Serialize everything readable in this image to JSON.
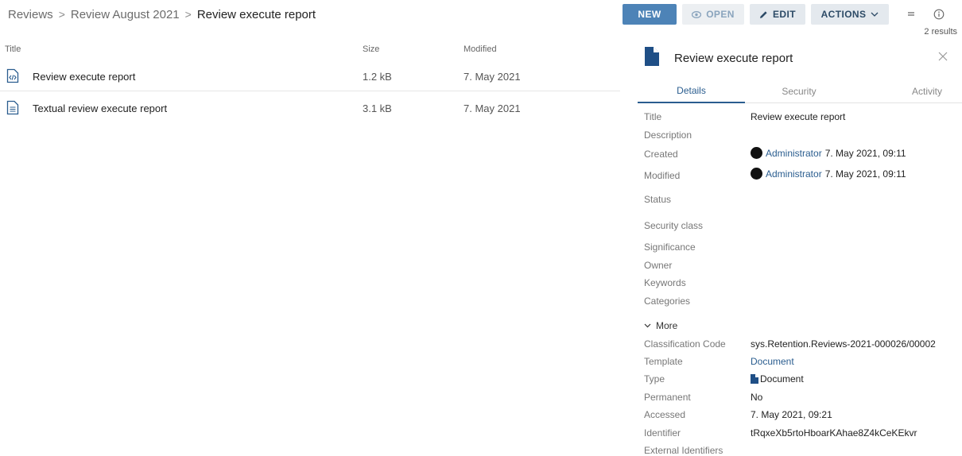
{
  "breadcrumb": {
    "items": [
      "Reviews",
      "Review August 2021"
    ],
    "current": "Review execute report"
  },
  "toolbar": {
    "new_label": "NEW",
    "open_label": "OPEN",
    "edit_label": "EDIT",
    "actions_label": "ACTIONS",
    "results_text": "2 results"
  },
  "list": {
    "columns": {
      "title": "Title",
      "size": "Size",
      "modified": "Modified"
    },
    "rows": [
      {
        "title": "Review execute report",
        "size": "1.2 kB",
        "modified": "7. May 2021",
        "icon": "code-file-icon"
      },
      {
        "title": "Textual review execute report",
        "size": "3.1 kB",
        "modified": "7. May 2021",
        "icon": "text-file-icon"
      }
    ]
  },
  "panel": {
    "title": "Review execute report",
    "tabs": [
      "Details",
      "Security",
      "Activity"
    ],
    "labels": {
      "title": "Title",
      "description": "Description",
      "created": "Created",
      "modified": "Modified",
      "status": "Status",
      "security_class": "Security class",
      "significance": "Significance",
      "owner": "Owner",
      "keywords": "Keywords",
      "categories": "Categories",
      "more": "More",
      "classification_code": "Classification Code",
      "template": "Template",
      "type": "Type",
      "permanent": "Permanent",
      "accessed": "Accessed",
      "identifier": "Identifier",
      "external_identifiers": "External Identifiers"
    },
    "values": {
      "title": "Review execute report",
      "created_user": "Administrator",
      "created_date": "7. May 2021, 09:11",
      "modified_user": "Administrator",
      "modified_date": "7. May 2021, 09:11",
      "classification_code": "sys.Retention.Reviews-2021-000026/00002",
      "template": "Document",
      "type": "Document",
      "permanent": "No",
      "accessed": "7. May 2021, 09:21",
      "identifier": "tRqxeXb5rtoHboarKAhae8Z4kCeKEkvr"
    }
  },
  "colors": {
    "primary": "#4d83b7",
    "link": "#2a5d8f",
    "doc_icon": "#1f4f86"
  }
}
